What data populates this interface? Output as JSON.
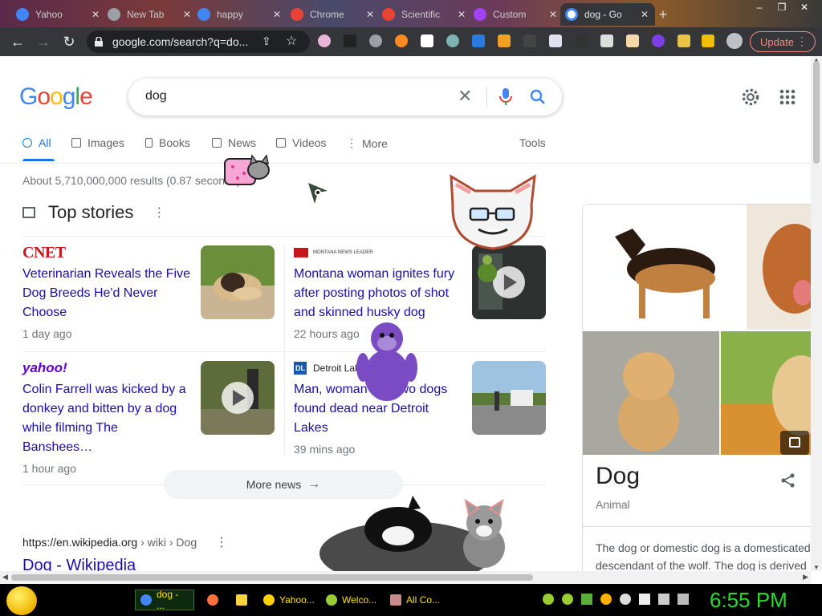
{
  "browser": {
    "tabs": [
      {
        "title": "Yahoo",
        "favicon_color": "#4285f4",
        "active": false
      },
      {
        "title": "New Tab",
        "favicon_color": "#9aa0a6",
        "active": false
      },
      {
        "title": "happy",
        "favicon_color": "#4285f4",
        "active": false
      },
      {
        "title": "Chrome",
        "favicon_color": "#ea4335",
        "active": false
      },
      {
        "title": "Scientific",
        "favicon_color": "#ea4335",
        "active": false
      },
      {
        "title": "Custom",
        "favicon_color": "#a142f4",
        "active": false
      },
      {
        "title": "dog - Go",
        "favicon_color": "#4285f4",
        "active": true
      }
    ],
    "address": "google.com/search?q=do...",
    "update_label": "Update"
  },
  "search": {
    "query": "dog",
    "tabs": [
      {
        "label": "All",
        "active": true
      },
      {
        "label": "Images"
      },
      {
        "label": "Books"
      },
      {
        "label": "News"
      },
      {
        "label": "Videos"
      },
      {
        "label": "More"
      },
      {
        "label": "Tools"
      }
    ],
    "result_stats": "About 5,710,000,000 results (0.87 seconds)"
  },
  "top_stories": {
    "heading": "Top stories",
    "stories": [
      {
        "source": "CNET",
        "title": "Veterinarian Reveals the Five Dog Breeds He'd Never Choose",
        "age": "1 day ago"
      },
      {
        "source": "MONTANA NEWS LEADER",
        "title": "Montana woman ignites fury after posting photos of shot and skinned husky dog",
        "age": "22 hours ago"
      },
      {
        "source": "yahoo!",
        "title": "Colin Farrell was kicked by a donkey and bitten by a dog while filming The Banshees…",
        "age": "1 hour ago"
      },
      {
        "source": "Detroit Lakes",
        "source_badge": "DL",
        "title": "Man, woman and two dogs found dead near Detroit Lakes",
        "age": "39 mins ago"
      }
    ],
    "more_news": "More news"
  },
  "wiki": {
    "url": "https://en.wikipedia.org",
    "crumb": " › wiki › Dog",
    "title": "Dog - Wikipedia"
  },
  "knowledge_panel": {
    "name": "Dog",
    "type": "Animal",
    "description": "The dog or domestic dog is a domesticated descendant of the wolf. The dog is derived"
  },
  "taskbar": {
    "items": [
      {
        "label": "dog - ...",
        "icon_color": "#4285f4",
        "active": true
      },
      {
        "label": "",
        "icon_color": "#ff7139"
      },
      {
        "label": "",
        "icon_color": "#f9d33c"
      },
      {
        "label": "Yahoo...",
        "icon_color": "#ffd100"
      },
      {
        "label": "Welco...",
        "icon_color": "#9acd32"
      },
      {
        "label": "All Co...",
        "icon_color": "#c98a8a"
      }
    ],
    "clock": "6:55 PM"
  }
}
